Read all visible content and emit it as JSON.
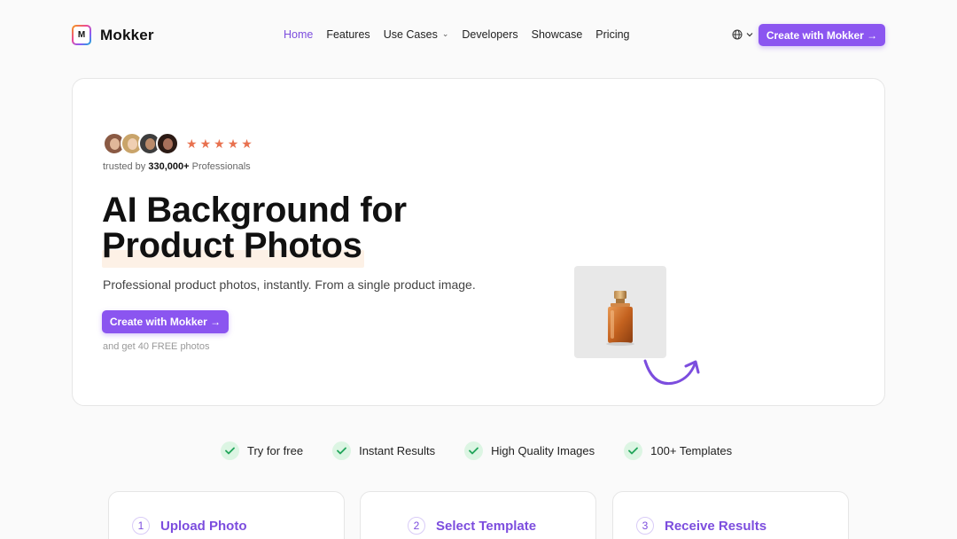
{
  "nav": {
    "logo_letter": "M",
    "brand": "Mokker",
    "menu": [
      {
        "label": "Home",
        "active": true
      },
      {
        "label": "Features",
        "active": false
      },
      {
        "label": "Use Cases",
        "active": false,
        "has_dropdown": true
      },
      {
        "label": "Developers",
        "active": false
      },
      {
        "label": "Showcase",
        "active": false
      },
      {
        "label": "Pricing",
        "active": false
      }
    ],
    "language_icon": "globe-icon",
    "cta": "Create with Mokker →"
  },
  "hero": {
    "rating_stars": 5,
    "trusted_prefix": "trusted by",
    "trusted_count": "330,000+",
    "trusted_suffix": "Professionals",
    "title_line1": "AI Background for",
    "title_line2": "Product Photos",
    "subtitle": "Professional product photos, instantly. From a single product image.",
    "cta": "Create with Mokker →",
    "note": "and get 40 FREE photos"
  },
  "features": [
    {
      "label": "Try for free"
    },
    {
      "label": "Instant Results"
    },
    {
      "label": "High Quality Images"
    },
    {
      "label": "100+ Templates"
    }
  ],
  "steps": [
    {
      "number": "1",
      "label": "Upload Photo"
    },
    {
      "number": "2",
      "label": "Select Template"
    },
    {
      "number": "3",
      "label": "Receive Results"
    }
  ],
  "colors": {
    "accent": "#8b55f0",
    "accent_text": "#7c4dde",
    "star": "#e8714f",
    "check_bg": "#dcf5e3",
    "check": "#22a55b",
    "highlight": "#fdf1e6"
  }
}
